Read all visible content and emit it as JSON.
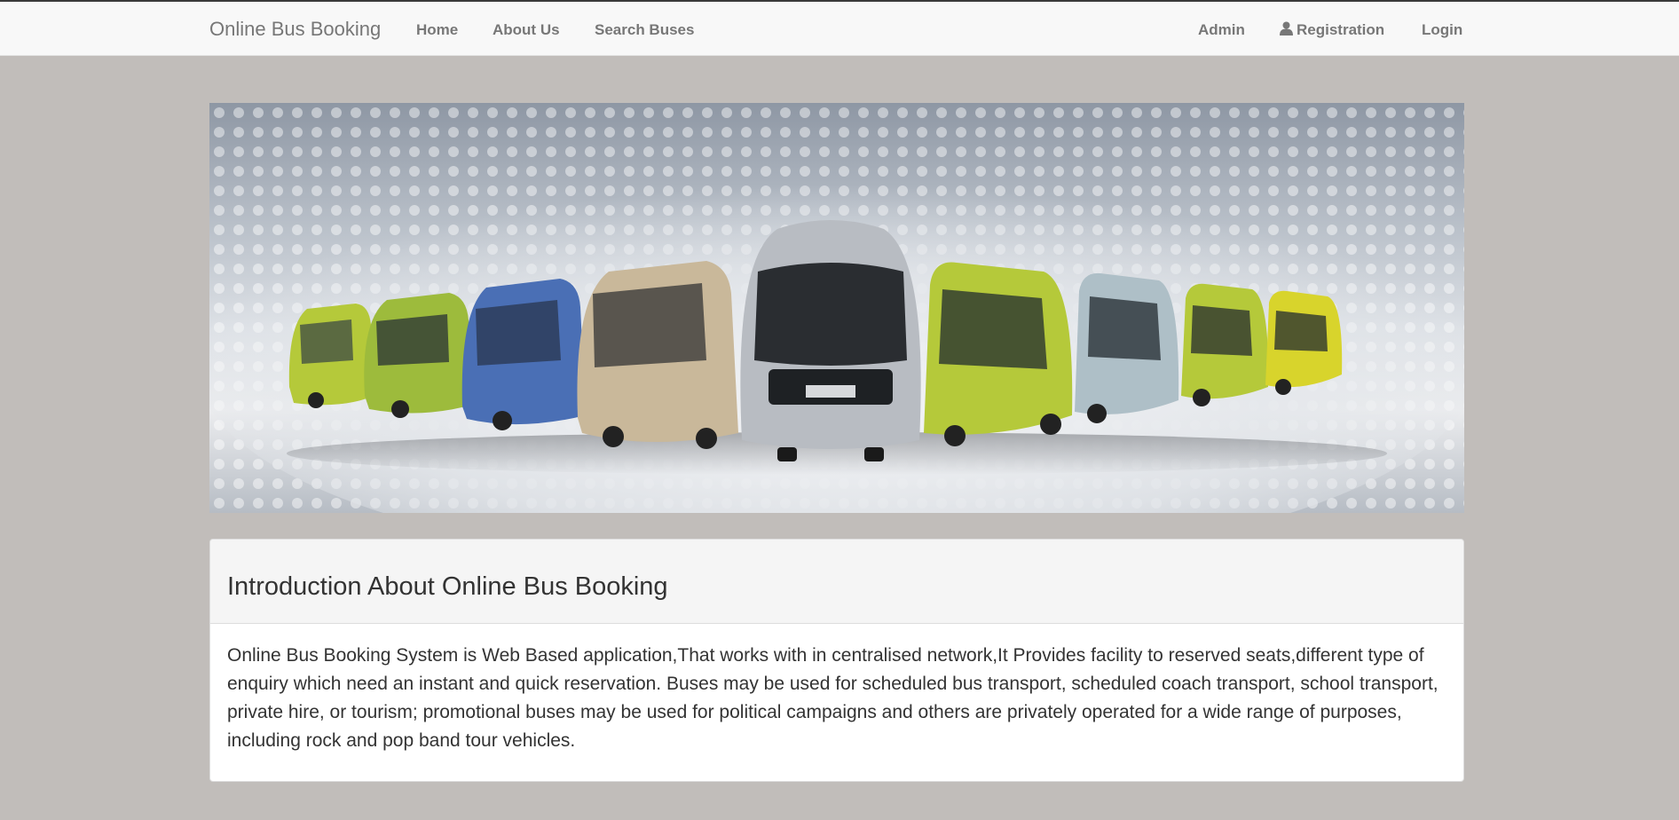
{
  "navbar": {
    "brand": "Online Bus Booking",
    "links_left": [
      "Home",
      "About Us",
      "Search Buses"
    ],
    "admin": "Admin",
    "registration": "Registration",
    "login": "Login"
  },
  "banner": {
    "image": "fleet of buses banner"
  },
  "intro": {
    "title": "Introduction About Online Bus Booking",
    "body": "Online Bus Booking System is Web Based application,That works with in centralised network,It Provides facility to reserved seats,different type of enquiry which need an instant and quick reservation. Buses may be used for scheduled bus transport, scheduled coach transport, school transport, private hire, or tourism; promotional buses may be used for political campaigns and others are privately operated for a wide range of purposes, including rock and pop band tour vehicles."
  },
  "colors": {
    "page_bg": "#c1bdba",
    "navbar_bg": "#f8f8f8",
    "nav_text": "#777777",
    "bus_lime": "#b5c93a",
    "bus_blue": "#4a6fb5",
    "bus_silver": "#b8bcc2",
    "bus_beige": "#c9b89a"
  }
}
